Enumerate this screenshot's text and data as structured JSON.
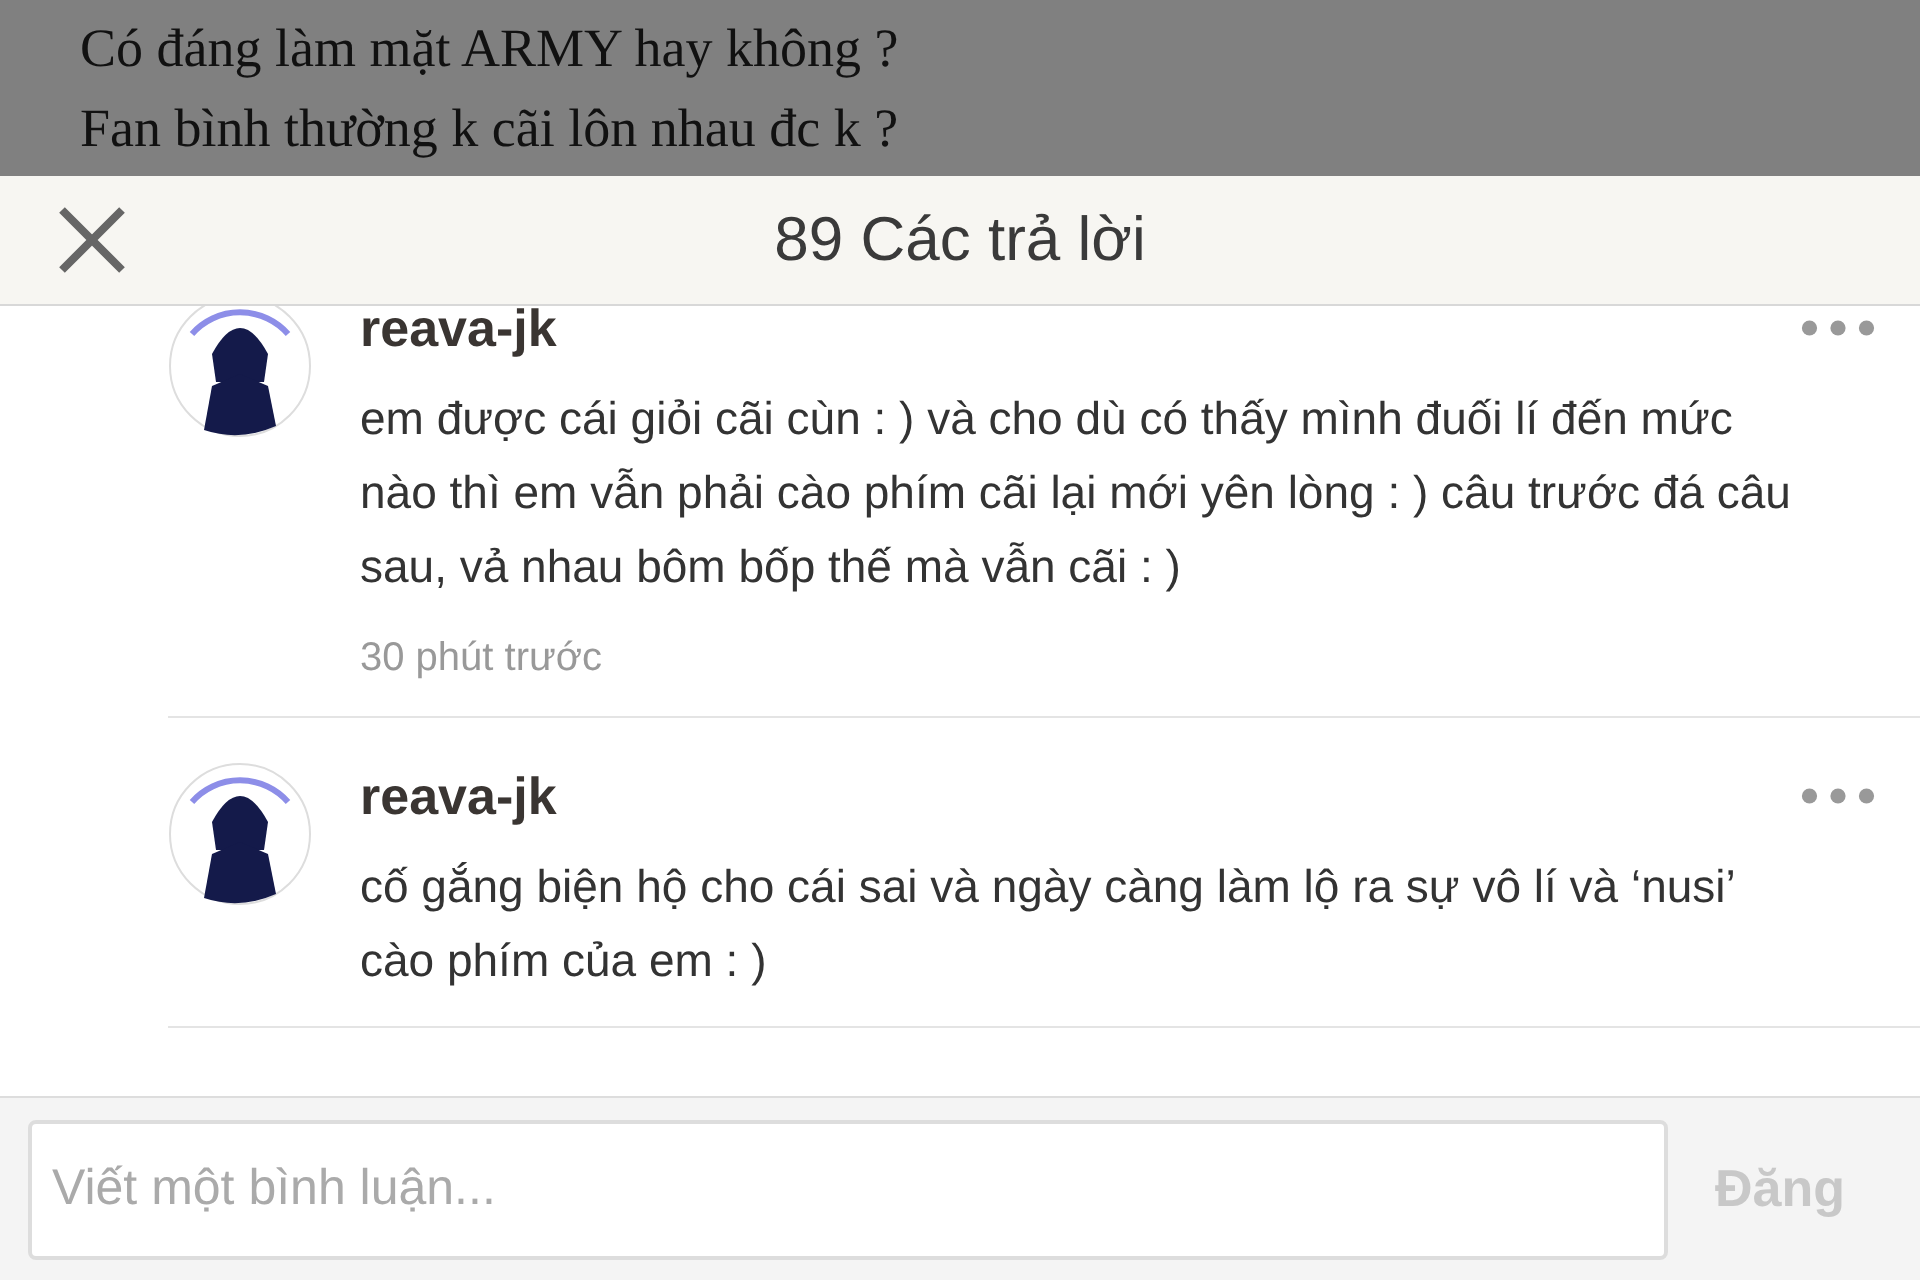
{
  "background_post": {
    "lines": [
      "Có đáng làm mặt ARMY hay không ?",
      "Fan bình thường k cãi lôn nhau đc k ?"
    ]
  },
  "sheet": {
    "title": "89 Các trả lời",
    "comments": [
      {
        "username": "reava-jk",
        "text": "em được cái giỏi cãi cùn : ) và cho dù có thấy mình đuối lí đến mức nào thì em vẫn phải cào phím cãi lại mới yên lòng : ) câu trước đá câu sau, vả nhau bôm bốp thế mà vẫn cãi : )",
        "time": "30 phút trước"
      },
      {
        "username": "reava-jk",
        "text": "cố gắng biện hộ cho cái sai và ngày càng làm lộ ra sự vô lí và ‘nusi’ cào phím của em : )"
      }
    ],
    "composer": {
      "placeholder": "Viết một bình luận...",
      "submit": "Đăng",
      "disabled": true
    }
  }
}
